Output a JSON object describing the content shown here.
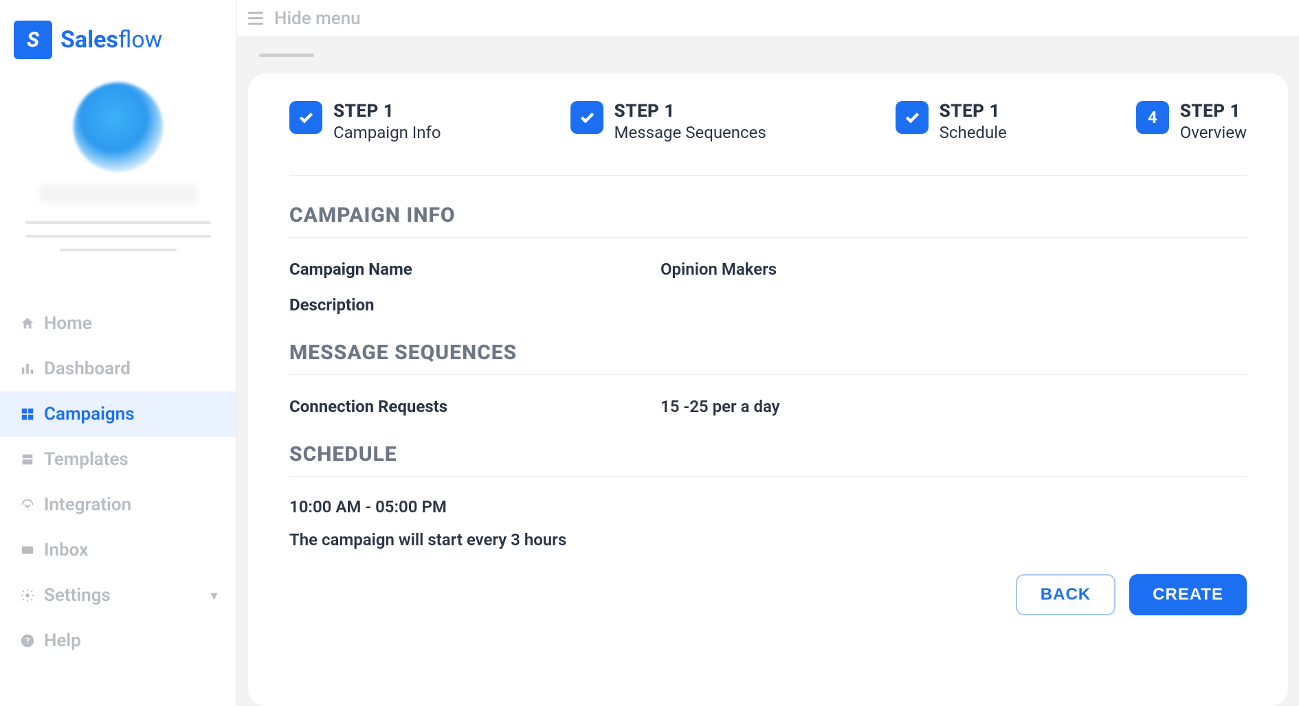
{
  "brand": {
    "name_bold": "Sales",
    "name_rest": "flow",
    "logo_text": "S"
  },
  "topbar": {
    "hide_menu": "Hide menu"
  },
  "sidebar": {
    "items": [
      {
        "label": "Home"
      },
      {
        "label": "Dashboard"
      },
      {
        "label": "Campaigns"
      },
      {
        "label": "Templates"
      },
      {
        "label": "Integration"
      },
      {
        "label": "Inbox"
      },
      {
        "label": "Settings"
      },
      {
        "label": "Help"
      }
    ]
  },
  "steps": [
    {
      "title": "STEP 1",
      "subtitle": "Campaign Info"
    },
    {
      "title": "STEP 1",
      "subtitle": "Message Sequences"
    },
    {
      "title": "STEP 1",
      "subtitle": "Schedule"
    },
    {
      "title": "STEP 1",
      "subtitle": "Overview",
      "number": "4"
    }
  ],
  "sections": {
    "campaign_info": {
      "heading": "CAMPAIGN INFO",
      "rows": [
        {
          "label": "Campaign Name",
          "value": "Opinion Makers"
        },
        {
          "label": "Description",
          "value": ""
        }
      ]
    },
    "message_sequences": {
      "heading": "MESSAGE SEQUENCES",
      "rows": [
        {
          "label": "Connection Requests",
          "value": "15 -25 per a day"
        }
      ]
    },
    "schedule": {
      "heading": "SCHEDULE",
      "lines": [
        "10:00 AM - 05:00 PM",
        "The campaign will start every 3 hours"
      ]
    }
  },
  "actions": {
    "back": "BACK",
    "create": "CREATE"
  }
}
